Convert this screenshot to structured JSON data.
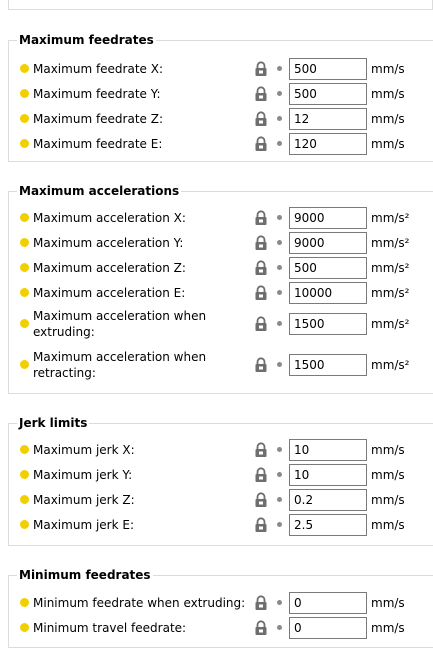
{
  "groups": [
    {
      "title": "Maximum feedrates",
      "rows": [
        {
          "label": "Maximum feedrate X:",
          "value": "500",
          "unit": "mm/s"
        },
        {
          "label": "Maximum feedrate Y:",
          "value": "500",
          "unit": "mm/s"
        },
        {
          "label": "Maximum feedrate Z:",
          "value": "12",
          "unit": "mm/s"
        },
        {
          "label": "Maximum feedrate E:",
          "value": "120",
          "unit": "mm/s"
        }
      ]
    },
    {
      "title": "Maximum accelerations",
      "rows": [
        {
          "label": "Maximum acceleration X:",
          "value": "9000",
          "unit": "mm/s²"
        },
        {
          "label": "Maximum acceleration Y:",
          "value": "9000",
          "unit": "mm/s²"
        },
        {
          "label": "Maximum acceleration Z:",
          "value": "500",
          "unit": "mm/s²"
        },
        {
          "label": "Maximum acceleration E:",
          "value": "10000",
          "unit": "mm/s²"
        },
        {
          "label": "Maximum acceleration when extruding:",
          "value": "1500",
          "unit": "mm/s²"
        },
        {
          "label": "Maximum acceleration when retracting:",
          "value": "1500",
          "unit": "mm/s²"
        }
      ]
    },
    {
      "title": "Jerk limits",
      "rows": [
        {
          "label": "Maximum jerk X:",
          "value": "10",
          "unit": "mm/s"
        },
        {
          "label": "Maximum jerk Y:",
          "value": "10",
          "unit": "mm/s"
        },
        {
          "label": "Maximum jerk Z:",
          "value": "0.2",
          "unit": "mm/s"
        },
        {
          "label": "Maximum jerk E:",
          "value": "2.5",
          "unit": "mm/s"
        }
      ]
    },
    {
      "title": "Minimum feedrates",
      "rows": [
        {
          "label": "Minimum feedrate when extruding:",
          "value": "0",
          "unit": "mm/s"
        },
        {
          "label": "Minimum travel feedrate:",
          "value": "0",
          "unit": "mm/s"
        }
      ]
    }
  ],
  "icons": {
    "bullet": "mode-simple-bullet-icon",
    "lock": "lock-icon",
    "reset": "reset-dot-icon"
  },
  "colors": {
    "bullet": "#f2d000",
    "lock": "#6e6e6e",
    "reset_dot": "#8a8a8a",
    "border": "#dcdcdc"
  }
}
